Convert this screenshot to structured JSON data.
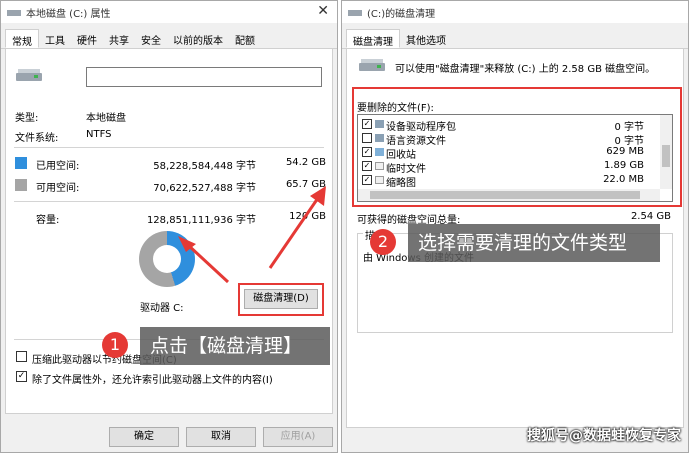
{
  "left_window": {
    "title": "本地磁盘 (C:) 属性",
    "tabs": [
      "常规",
      "工具",
      "硬件",
      "共享",
      "安全",
      "以前的版本",
      "配额"
    ],
    "name_input_value": "",
    "type_label": "类型:",
    "type_value": "本地磁盘",
    "fs_label": "文件系统:",
    "fs_value": "NTFS",
    "used_label": "已用空间:",
    "used_bytes": "58,228,584,448 字节",
    "used_gb": "54.2 GB",
    "free_label": "可用空间:",
    "free_bytes": "70,622,527,488 字节",
    "free_gb": "65.7 GB",
    "capacity_label": "容量:",
    "capacity_bytes": "128,851,111,936 字节",
    "capacity_gb": "120 GB",
    "drive_label": "驱动器 C:",
    "cleanup_button": "磁盘清理(D)",
    "compress_label": "压缩此驱动器以节约磁盘空间(C)",
    "index_label": "除了文件属性外，还允许索引此驱动器上文件的内容(I)",
    "ok_button": "确定",
    "cancel_button": "取消",
    "apply_button": "应用(A)",
    "used_fraction": 0.452,
    "used_color": "#2f8fdd",
    "free_color": "#a5a5a5"
  },
  "right_window": {
    "title": "(C:)的磁盘清理",
    "tabs": [
      "磁盘清理",
      "其他选项"
    ],
    "intro": "可以使用\"磁盘清理\"来释放  (C:) 上的 2.58 GB 磁盘空间。",
    "files_label": "要删除的文件(F):",
    "files": [
      {
        "name": "设备驱动程序包",
        "size": "0 字节",
        "checked": true
      },
      {
        "name": "语言资源文件",
        "size": "0 字节",
        "checked": false
      },
      {
        "name": "回收站",
        "size": "629 MB",
        "checked": true
      },
      {
        "name": "临时文件",
        "size": "1.89 GB",
        "checked": true
      },
      {
        "name": "缩略图",
        "size": "22.0 MB",
        "checked": true
      }
    ],
    "gain_label": "可获得的磁盘空间总量:",
    "gain_value": "2.54 GB",
    "desc_label": "描",
    "desc_text": "由 Windows 创建的文件"
  },
  "callouts": {
    "step1_number": "1",
    "step1_text": "点击【磁盘清理】",
    "step2_number": "2",
    "step2_text": "选择需要清理的文件类型"
  },
  "watermark": "搜狐号@数据蛙恢复专家",
  "accent_red": "#e53935"
}
